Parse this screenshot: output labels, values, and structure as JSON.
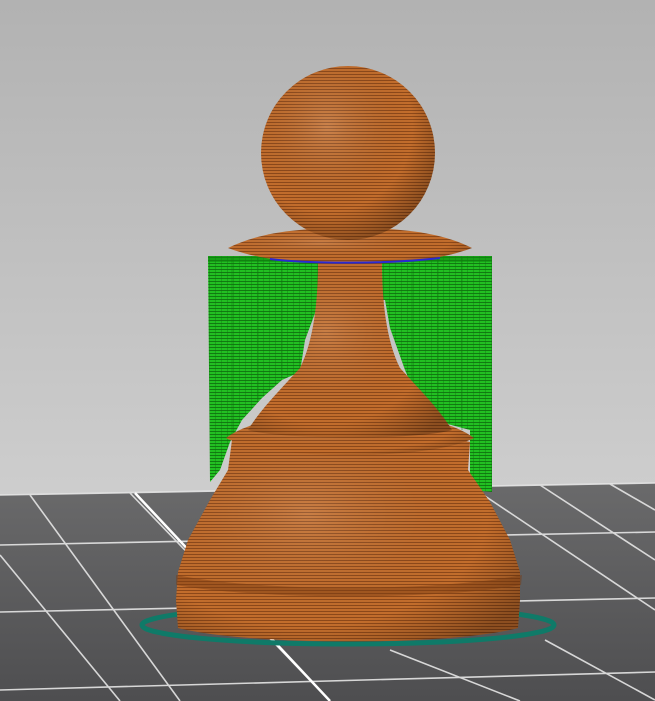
{
  "viewport": {
    "kind": "3d-slicer-preview",
    "model": "pawn",
    "colors": {
      "background_top": "#b2b2b2",
      "background_bottom": "#d9d9d9",
      "bed_surface": "#5b5b5c",
      "bed_grid": "#e8e8e8",
      "extrusion_model": "#bf6a2a",
      "extrusion_dark": "#7a3c12",
      "support_material": "#1fb51f",
      "support_dark": "#0f7a0f",
      "skirt": "#0f7a68",
      "wipe_line": "#2a2ad0"
    }
  }
}
